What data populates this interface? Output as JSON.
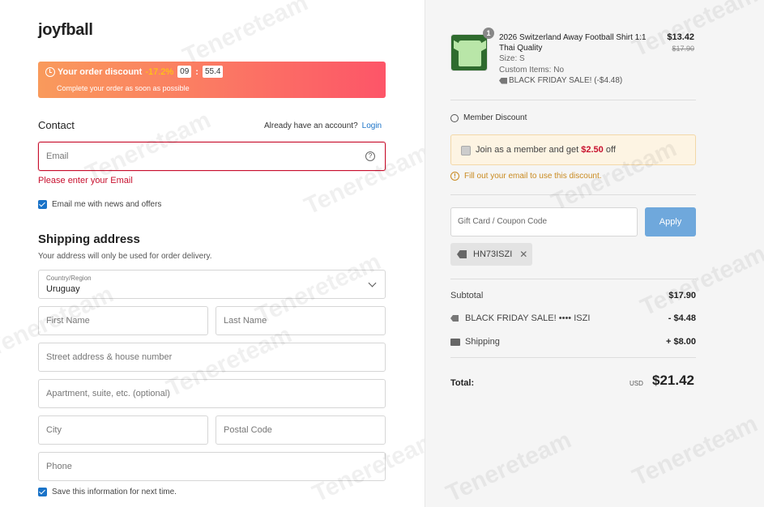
{
  "brand": "joyfball",
  "discount": {
    "label": "Your order discount",
    "percent": "-17.2%",
    "minutes": "09",
    "colon": ":",
    "seconds": "55.4",
    "subtext": "Complete your order as soon as possible"
  },
  "contact": {
    "title": "Contact",
    "account_prompt": "Already have an account?",
    "login_label": "Login",
    "email_placeholder": "Email",
    "help_glyph": "?",
    "error": "Please enter your Email",
    "newsletter_label": "Email me with news and offers"
  },
  "shipping": {
    "title": "Shipping address",
    "subtitle": "Your address will only be used for order delivery.",
    "country_label": "Country/Region",
    "country_value": "Uruguay",
    "first_name": "First Name",
    "last_name": "Last Name",
    "street": "Street address & house number",
    "apartment": "Apartment, suite, etc. (optional)",
    "city": "City",
    "postal": "Postal Code",
    "phone": "Phone",
    "save_info_label": "Save this information for next time."
  },
  "order": {
    "qty": "1",
    "product_name": "2026 Switzerland Away Football Shirt 1:1 Thai Quality",
    "size": "Size: S",
    "custom": "Custom Items: No",
    "promo": "BLACK FRIDAY SALE! (-$4.48)",
    "price": "$13.42",
    "original_price": "$17.90"
  },
  "member": {
    "title": "Member Discount",
    "join_text": "Join as a member and get",
    "join_amount": "$2.50",
    "join_suffix": "off",
    "warning_glyph": "!",
    "warning": "Fill out your email to use this discount."
  },
  "coupon": {
    "placeholder": "Gift Card / Coupon Code",
    "apply_label": "Apply",
    "applied_code": "HN73ISZI",
    "remove_glyph": "✕"
  },
  "summary": {
    "subtotal_label": "Subtotal",
    "subtotal_value": "$17.90",
    "discount_label": "BLACK FRIDAY SALE! •••• ISZI",
    "discount_value": "- $4.48",
    "shipping_label": "Shipping",
    "shipping_value": "+ $8.00",
    "total_label": "Total:",
    "currency": "USD",
    "total_value": "$21.42"
  },
  "watermark": "Tenereteam",
  "colors": {
    "accent": "#1a73c8",
    "error": "#c8102e",
    "apply_button": "#6fa8dc"
  }
}
